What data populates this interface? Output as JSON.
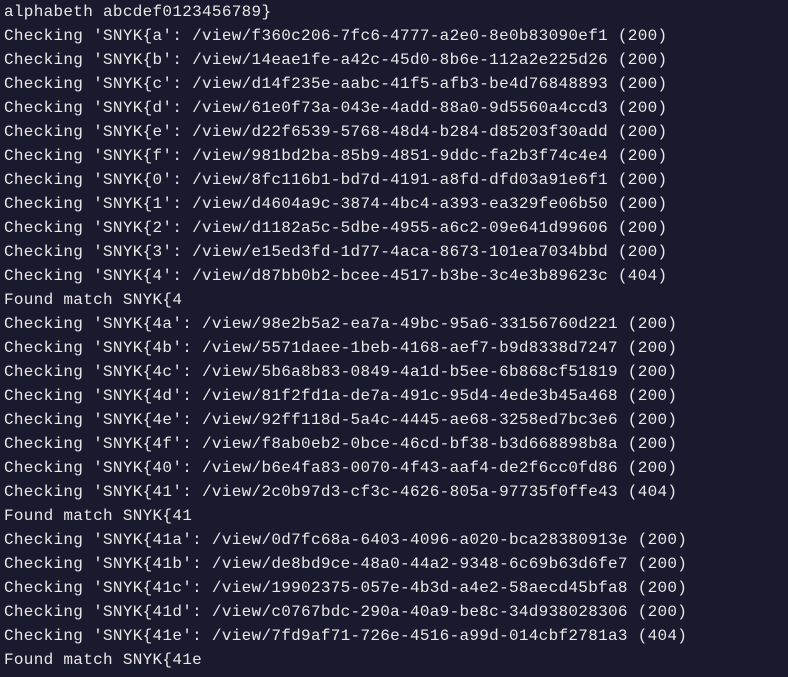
{
  "lines": [
    "alphabeth abcdef0123456789}",
    "Checking 'SNYK{a': /view/f360c206-7fc6-4777-a2e0-8e0b83090ef1 (200)",
    "Checking 'SNYK{b': /view/14eae1fe-a42c-45d0-8b6e-112a2e225d26 (200)",
    "Checking 'SNYK{c': /view/d14f235e-aabc-41f5-afb3-be4d76848893 (200)",
    "Checking 'SNYK{d': /view/61e0f73a-043e-4add-88a0-9d5560a4ccd3 (200)",
    "Checking 'SNYK{e': /view/d22f6539-5768-48d4-b284-d85203f30add (200)",
    "Checking 'SNYK{f': /view/981bd2ba-85b9-4851-9ddc-fa2b3f74c4e4 (200)",
    "Checking 'SNYK{0': /view/8fc116b1-bd7d-4191-a8fd-dfd03a91e6f1 (200)",
    "Checking 'SNYK{1': /view/d4604a9c-3874-4bc4-a393-ea329fe06b50 (200)",
    "Checking 'SNYK{2': /view/d1182a5c-5dbe-4955-a6c2-09e641d99606 (200)",
    "Checking 'SNYK{3': /view/e15ed3fd-1d77-4aca-8673-101ea7034bbd (200)",
    "Checking 'SNYK{4': /view/d87bb0b2-bcee-4517-b3be-3c4e3b89623c (404)",
    "Found match SNYK{4",
    "Checking 'SNYK{4a': /view/98e2b5a2-ea7a-49bc-95a6-33156760d221 (200)",
    "Checking 'SNYK{4b': /view/5571daee-1beb-4168-aef7-b9d8338d7247 (200)",
    "Checking 'SNYK{4c': /view/5b6a8b83-0849-4a1d-b5ee-6b868cf51819 (200)",
    "Checking 'SNYK{4d': /view/81f2fd1a-de7a-491c-95d4-4ede3b45a468 (200)",
    "Checking 'SNYK{4e': /view/92ff118d-5a4c-4445-ae68-3258ed7bc3e6 (200)",
    "Checking 'SNYK{4f': /view/f8ab0eb2-0bce-46cd-bf38-b3d668898b8a (200)",
    "Checking 'SNYK{40': /view/b6e4fa83-0070-4f43-aaf4-de2f6cc0fd86 (200)",
    "Checking 'SNYK{41': /view/2c0b97d3-cf3c-4626-805a-97735f0ffe43 (404)",
    "Found match SNYK{41",
    "Checking 'SNYK{41a': /view/0d7fc68a-6403-4096-a020-bca28380913e (200)",
    "Checking 'SNYK{41b': /view/de8bd9ce-48a0-44a2-9348-6c69b63d6fe7 (200)",
    "Checking 'SNYK{41c': /view/19902375-057e-4b3d-a4e2-58aecd45bfa8 (200)",
    "Checking 'SNYK{41d': /view/c0767bdc-290a-40a9-be8c-34d938028306 (200)",
    "Checking 'SNYK{41e': /view/7fd9af71-726e-4516-a99d-014cbf2781a3 (404)",
    "Found match SNYK{41e"
  ]
}
